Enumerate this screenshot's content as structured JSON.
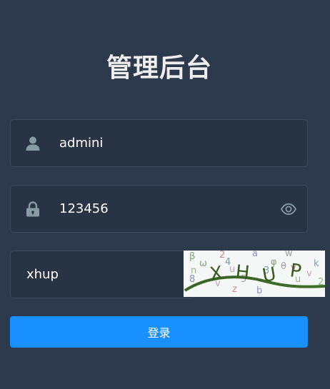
{
  "title": "管理后台",
  "username": {
    "value": "admini",
    "icon": "user-icon"
  },
  "password": {
    "value": "123456",
    "icon": "lock-icon",
    "toggle_icon": "eye-icon"
  },
  "captcha_input": {
    "value": "xhup"
  },
  "captcha_image": {
    "code_text": "XHUP",
    "noise_chars": [
      "β",
      "2",
      "a",
      "w",
      "n",
      "u",
      "3",
      "φ",
      "v",
      "8",
      "5",
      "u",
      "v",
      "k",
      "ω",
      "z",
      "b",
      "θ",
      "2",
      "v",
      "4"
    ]
  },
  "login_button": {
    "label": "登录"
  },
  "colors": {
    "background": "#2d3a4b",
    "input_bg": "#283443",
    "accent": "#1890ff",
    "icon": "#889aa4"
  }
}
